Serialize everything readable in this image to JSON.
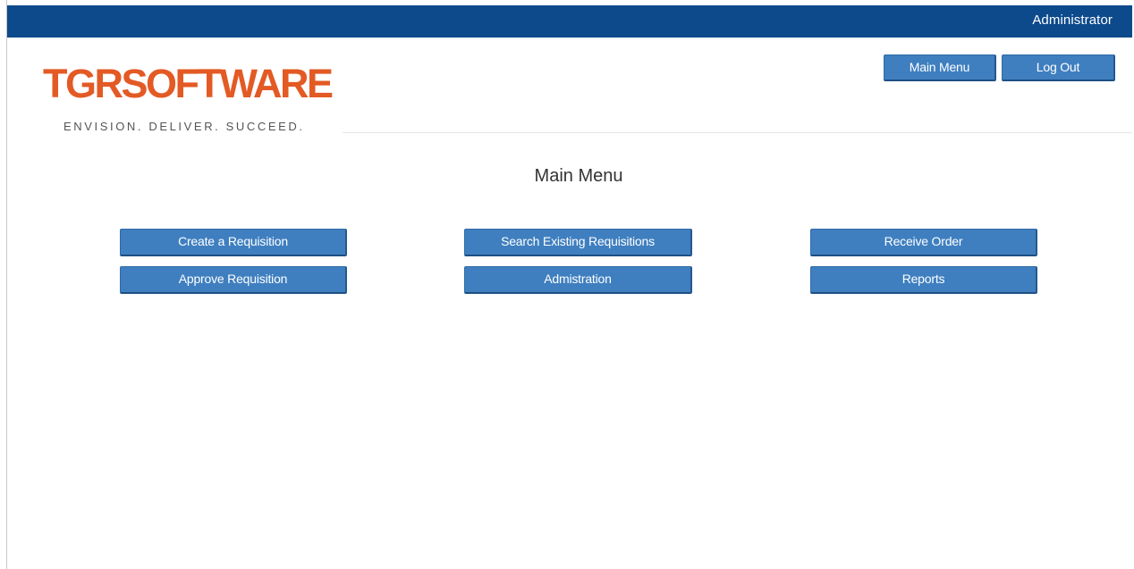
{
  "header": {
    "user": "Administrator",
    "main_menu_button": "Main Menu",
    "logout_button": "Log Out"
  },
  "logo": {
    "name": "TGRSOFTWARE",
    "tagline": "ENVISION. DELIVER. SUCCEED."
  },
  "page": {
    "title": "Main Menu"
  },
  "menu": {
    "create_requisition": "Create a Requisition",
    "search_requisitions": "Search Existing Requisitions",
    "receive_order": "Receive Order",
    "approve_requisition": "Approve Requisition",
    "administration": "Admistration",
    "reports": "Reports"
  },
  "colors": {
    "top_bar": "#0c4a8c",
    "button": "#3f7fc0",
    "logo": "#e35a24"
  }
}
